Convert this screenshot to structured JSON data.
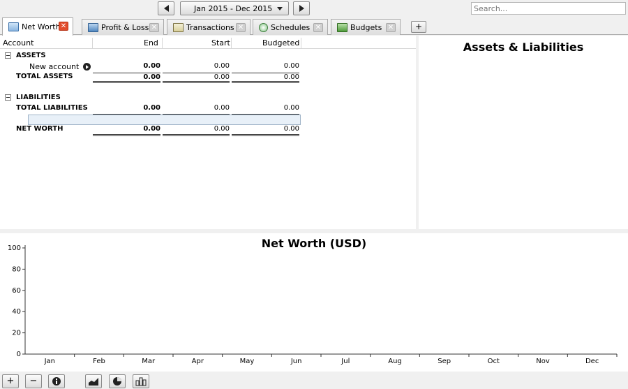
{
  "toolbar": {
    "prev_icon": "triangle-left",
    "next_icon": "triangle-right",
    "date_range": "Jan 2015 - Dec 2015",
    "search_placeholder": "Search..."
  },
  "tabs": [
    {
      "label": "Net Worth",
      "icon": "chart-line-icon",
      "active": true
    },
    {
      "label": "Profit & Loss",
      "icon": "bar-chart-icon",
      "active": false
    },
    {
      "label": "Transactions",
      "icon": "ledger-icon",
      "active": false
    },
    {
      "label": "Schedules",
      "icon": "clock-icon",
      "active": false
    },
    {
      "label": "Budgets",
      "icon": "money-icon",
      "active": false
    }
  ],
  "table": {
    "headers": {
      "account": "Account",
      "end": "End",
      "start": "Start",
      "budgeted": "Budgeted"
    },
    "assets": {
      "label": "ASSETS",
      "items": [
        {
          "name": "New account",
          "end": "0.00",
          "start": "0.00",
          "budgeted": "0.00"
        }
      ],
      "total": {
        "label": "TOTAL ASSETS",
        "end": "0.00",
        "start": "0.00",
        "budgeted": "0.00"
      }
    },
    "liabilities": {
      "label": "LIABILITIES",
      "total": {
        "label": "TOTAL LIABILITIES",
        "end": "0.00",
        "start": "0.00",
        "budgeted": "0.00"
      }
    },
    "net_worth": {
      "label": "NET WORTH",
      "end": "0.00",
      "start": "0.00",
      "budgeted": "0.00"
    }
  },
  "right_panel": {
    "title": "Assets & Liabilities"
  },
  "chart_data": {
    "type": "line",
    "title": "Net Worth (USD)",
    "categories": [
      "Jan",
      "Feb",
      "Mar",
      "Apr",
      "May",
      "Jun",
      "Jul",
      "Aug",
      "Sep",
      "Oct",
      "Nov",
      "Dec"
    ],
    "yticks": [
      0,
      20,
      40,
      60,
      80,
      100
    ],
    "ylim": [
      0,
      100
    ],
    "series": []
  },
  "bottom": {
    "add": "+",
    "remove": "−"
  }
}
